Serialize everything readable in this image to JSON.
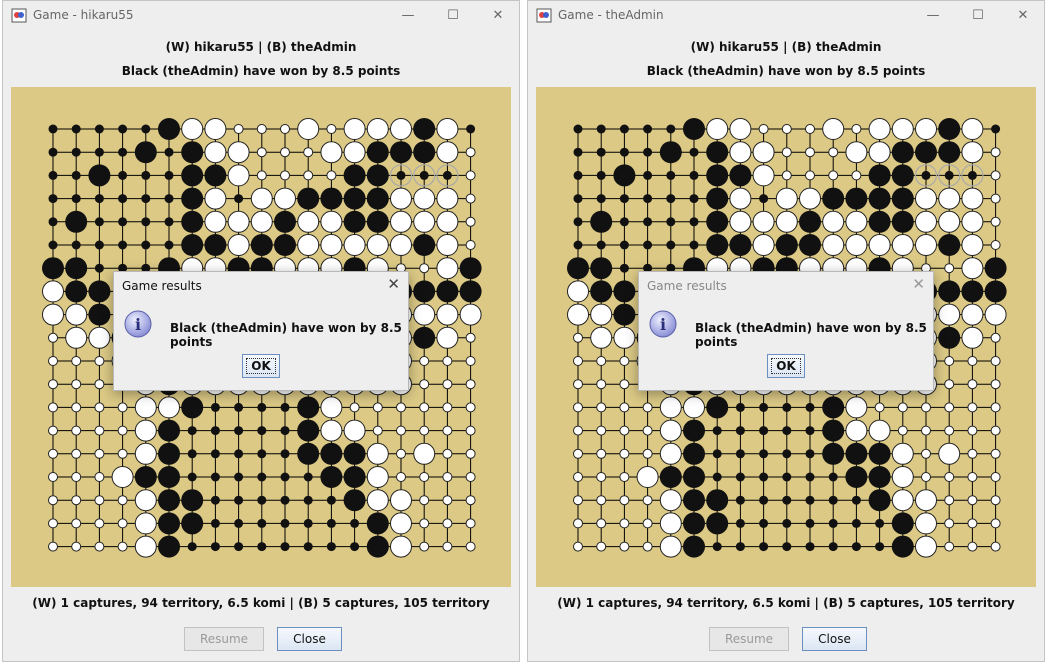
{
  "windows": [
    {
      "title": "Game - hikaru55",
      "players": "(W) hikaru55 | (B) theAdmin",
      "result": "Black (theAdmin) have won by 8.5 points",
      "score": "(W) 1 captures, 94 territory, 6.5 komi | (B) 5 captures, 105 territory",
      "resume_label": "Resume",
      "close_label": "Close",
      "dialog": {
        "title": "Game results",
        "message": "Black (theAdmin) have won by 8.5 points",
        "ok_label": "OK",
        "active": true
      }
    },
    {
      "title": "Game - theAdmin",
      "players": "(W) hikaru55 | (B) theAdmin",
      "result": "Black (theAdmin) have won by 8.5 points",
      "score": "(W) 1 captures, 94 territory, 6.5 komi | (B) 5 captures, 105 territory",
      "resume_label": "Resume",
      "close_label": "Close",
      "dialog": {
        "title": "Game results",
        "message": "Black (theAdmin) have won by 8.5 points",
        "ok_label": "OK",
        "active": false
      }
    }
  ],
  "board": {
    "size": 19,
    "legend": "B = black stone, W = white stone, b/w = territory point, x/y = dead stone, . = empty",
    "rows": [
      "bbbbbBWWwwwWwWWWBWb",
      "bbbbBbBWWwwwWWBBBWw",
      "bbBbbbBBWwwwwBByyyw",
      "bbbbbbBWbWWBBBBWWWw",
      "bBbbbbBWWWBWWBBWWWw",
      "bbbbbbBBWBBWWWWWBWw",
      "BBbbbBWWBBWWWBWwwWB",
      "WBBbbBBBBBWWWWBBBBB",
      "WWBbbBBBWWBWWBWWWWW",
      "wWWBbBWWWBWWWWWWBWw",
      "wwwWBBWWWWWWWWWWwww",
      "wwwwWBWWWWWWWWWWwww",
      "wwwwWWBbbbbBWwwwwww",
      "wwwwWBbbbbbBWWwwwww",
      "wwwwWBbbbbbBBBWwWww",
      "wwwWBBbbbbbbBBWwwww",
      "wwwwWBBbbbbbbBWWwww",
      "wwwwWBBbbbbbbbBWwww",
      "wwwwWBbbbbbbbbBWwww"
    ],
    "colors": {
      "board": "#dbc985",
      "black": "#111111",
      "white": "#ffffff",
      "dead_white": "#cccccc"
    }
  }
}
